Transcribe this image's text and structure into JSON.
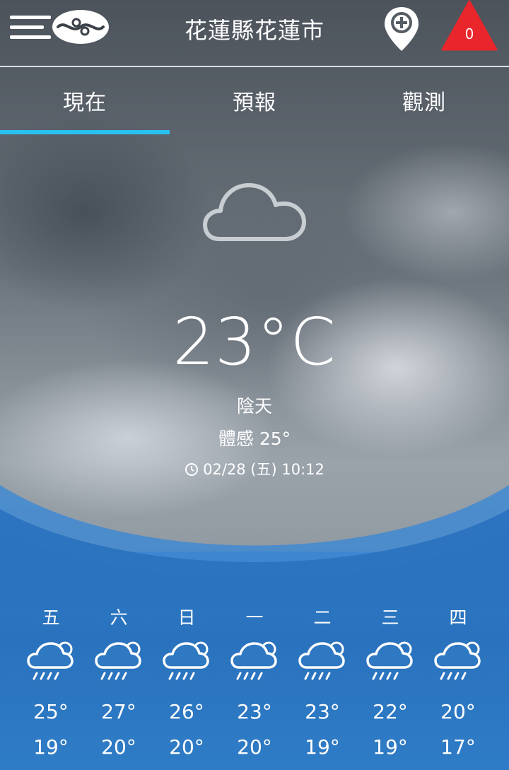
{
  "header": {
    "location": "花蓮縣花蓮市",
    "alert_count": "0"
  },
  "tabs": [
    {
      "label": "現在",
      "active": true
    },
    {
      "label": "預報",
      "active": false
    },
    {
      "label": "觀測",
      "active": false
    }
  ],
  "current": {
    "icon": "cloud-icon",
    "temperature": "23°C",
    "condition": "陰天",
    "feels_like_label": "體感",
    "feels_like_value": "25°",
    "updated": "02/28 (五) 10:12"
  },
  "forecast": [
    {
      "day": "五",
      "high": "25°",
      "low": "19°",
      "icon": "rain-cloud-icon"
    },
    {
      "day": "六",
      "high": "27°",
      "low": "20°",
      "icon": "rain-cloud-icon"
    },
    {
      "day": "日",
      "high": "26°",
      "low": "20°",
      "icon": "rain-cloud-icon"
    },
    {
      "day": "一",
      "high": "23°",
      "low": "20°",
      "icon": "rain-cloud-icon"
    },
    {
      "day": "二",
      "high": "23°",
      "low": "19°",
      "icon": "rain-cloud-icon"
    },
    {
      "day": "三",
      "high": "22°",
      "low": "19°",
      "icon": "rain-cloud-icon"
    },
    {
      "day": "四",
      "high": "20°",
      "low": "17°",
      "icon": "rain-cloud-icon"
    }
  ],
  "colors": {
    "accent": "#29c1ef",
    "alert": "#e8262b",
    "forecast_bg": "#2a72bd"
  }
}
